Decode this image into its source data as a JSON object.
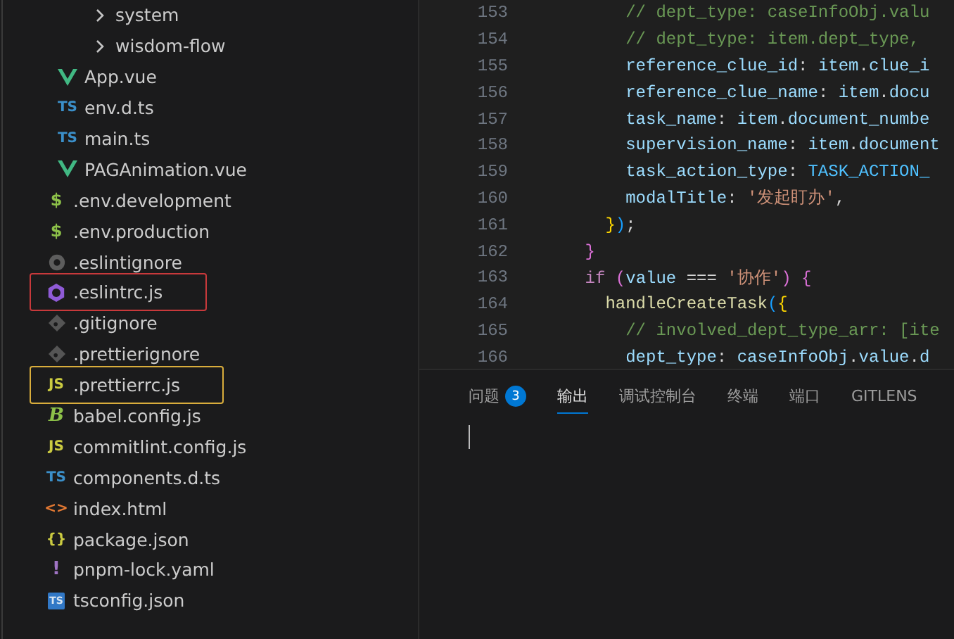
{
  "explorer": {
    "tree": [
      {
        "children": [
          {
            "children": [
              {
                "kind": "folder",
                "label": "system",
                "expanded": false
              },
              {
                "kind": "folder",
                "label": "wisdom-flow",
                "expanded": false
              }
            ]
          },
          {
            "kind": "vue",
            "label": "App.vue"
          },
          {
            "kind": "ts",
            "glyph": "TS",
            "label": "env.d.ts"
          },
          {
            "kind": "ts",
            "glyph": "TS",
            "label": "main.ts"
          },
          {
            "kind": "vue",
            "label": "PAGAnimation.vue"
          }
        ]
      },
      {
        "kind": "env",
        "glyph": "$",
        "label": ".env.development"
      },
      {
        "kind": "env",
        "glyph": "$",
        "label": ".env.production"
      },
      {
        "kind": "ignore",
        "label": ".eslintignore"
      },
      {
        "kind": "eslint",
        "label": ".eslintrc.js",
        "color": "#c8393b"
      },
      {
        "kind": "git",
        "label": ".gitignore"
      },
      {
        "kind": "git",
        "label": ".prettierignore"
      },
      {
        "kind": "js",
        "glyph": "JS",
        "label": ".prettierrc.js",
        "color": "#d9ad3c"
      },
      {
        "kind": "babel",
        "glyph": "B",
        "label": "babel.config.js"
      },
      {
        "kind": "js",
        "glyph": "JS",
        "label": "commitlint.config.js"
      },
      {
        "kind": "ts",
        "glyph": "TS",
        "label": "components.d.ts"
      },
      {
        "kind": "html",
        "glyph": "<>",
        "label": "index.html"
      },
      {
        "kind": "json",
        "glyph": "{}",
        "label": "package.json"
      },
      {
        "kind": "yaml",
        "glyph": "!",
        "label": "pnpm-lock.yaml"
      },
      {
        "kind": "tsconfig",
        "glyph": "TS",
        "label": "tsconfig.json"
      }
    ]
  },
  "editor": {
    "lines": [
      {
        "number": "153",
        "tokens": [
          {
            "kind": "comment",
            "t": "        // dept_type: caseInfoObj.valu"
          }
        ]
      },
      {
        "number": "154",
        "tokens": [
          {
            "kind": "comment",
            "t": "        // dept_type: item.dept_type,"
          }
        ]
      },
      {
        "number": "155",
        "tokens": [
          {
            "kind": "prop",
            "t": "        reference_clue_id"
          },
          {
            "kind": "punc",
            "t": ": "
          },
          {
            "kind": "var",
            "t": "item"
          },
          {
            "kind": "punc",
            "t": "."
          },
          {
            "kind": "prop",
            "t": "clue_i"
          }
        ]
      },
      {
        "number": "156",
        "tokens": [
          {
            "kind": "prop",
            "t": "        reference_clue_name"
          },
          {
            "kind": "punc",
            "t": ": "
          },
          {
            "kind": "var",
            "t": "item"
          },
          {
            "kind": "punc",
            "t": "."
          },
          {
            "kind": "prop",
            "t": "docu"
          }
        ]
      },
      {
        "number": "157",
        "tokens": [
          {
            "kind": "prop",
            "t": "        task_name"
          },
          {
            "kind": "punc",
            "t": ": "
          },
          {
            "kind": "var",
            "t": "item"
          },
          {
            "kind": "punc",
            "t": "."
          },
          {
            "kind": "prop",
            "t": "document_numbe"
          }
        ]
      },
      {
        "number": "158",
        "tokens": [
          {
            "kind": "prop",
            "t": "        supervision_name"
          },
          {
            "kind": "punc",
            "t": ": "
          },
          {
            "kind": "var",
            "t": "item"
          },
          {
            "kind": "punc",
            "t": "."
          },
          {
            "kind": "prop",
            "t": "document"
          }
        ]
      },
      {
        "number": "159",
        "tokens": [
          {
            "kind": "prop",
            "t": "        task_action_type"
          },
          {
            "kind": "punc",
            "t": ": "
          },
          {
            "kind": "const",
            "t": "TASK_ACTION_"
          }
        ]
      },
      {
        "number": "160",
        "tokens": [
          {
            "kind": "prop",
            "t": "        modalTitle"
          },
          {
            "kind": "punc",
            "t": ": "
          },
          {
            "kind": "str",
            "t": "'发起盯办'"
          },
          {
            "kind": "punc",
            "t": ","
          }
        ]
      },
      {
        "number": "161",
        "tokens": [
          {
            "kind": "b1",
            "t": "      }"
          },
          {
            "kind": "b3",
            "t": ")"
          },
          {
            "kind": "punc",
            "t": ";"
          }
        ]
      },
      {
        "number": "162",
        "tokens": [
          {
            "kind": "b2",
            "t": "    }"
          }
        ]
      },
      {
        "number": "163",
        "tokens": [
          {
            "kind": "kw",
            "t": "    if"
          },
          {
            "kind": "b2",
            "t": " ("
          },
          {
            "kind": "prop",
            "t": "value"
          },
          {
            "kind": "punc",
            "t": " === "
          },
          {
            "kind": "str",
            "t": "'协作'"
          },
          {
            "kind": "b2",
            "t": ")"
          },
          {
            "kind": "b2",
            "t": " {"
          }
        ]
      },
      {
        "number": "164",
        "tokens": [
          {
            "kind": "fn",
            "t": "      handleCreateTask"
          },
          {
            "kind": "b3",
            "t": "("
          },
          {
            "kind": "b1",
            "t": "{"
          }
        ]
      },
      {
        "number": "165",
        "tokens": [
          {
            "kind": "comment",
            "t": "        // involved_dept_type_arr: [ite"
          }
        ]
      },
      {
        "number": "166",
        "tokens": [
          {
            "kind": "prop",
            "t": "        dept_type"
          },
          {
            "kind": "punc",
            "t": ": "
          },
          {
            "kind": "var",
            "t": "caseInfoObj"
          },
          {
            "kind": "punc",
            "t": "."
          },
          {
            "kind": "prop",
            "t": "value"
          },
          {
            "kind": "punc",
            "t": "."
          },
          {
            "kind": "prop",
            "t": "d"
          }
        ]
      }
    ]
  },
  "panel": {
    "tabs": [
      {
        "label": "问题",
        "badge": "3",
        "selected": false
      },
      {
        "label": "输出",
        "selected": true
      },
      {
        "label": "调试控制台",
        "selected": false
      },
      {
        "label": "终端",
        "selected": false
      },
      {
        "label": "端口",
        "selected": false
      },
      {
        "label": "GITLENS",
        "selected": false
      }
    ]
  }
}
